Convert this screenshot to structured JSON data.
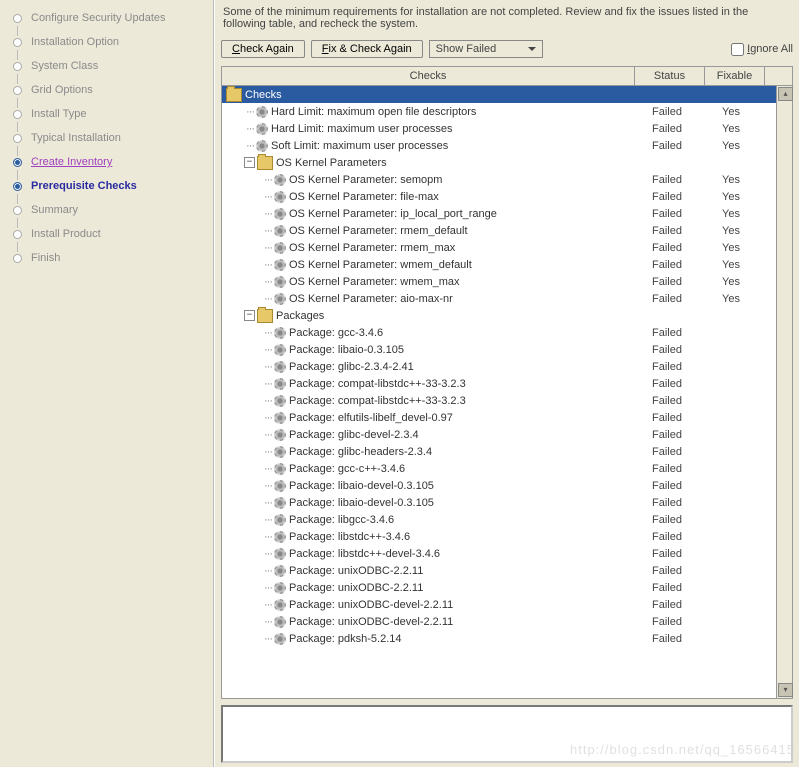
{
  "sidebar": {
    "steps": [
      {
        "label": "Configure Security Updates",
        "state": "pending"
      },
      {
        "label": "Installation Option",
        "state": "pending"
      },
      {
        "label": "System Class",
        "state": "pending"
      },
      {
        "label": "Grid Options",
        "state": "pending"
      },
      {
        "label": "Install Type",
        "state": "pending"
      },
      {
        "label": "Typical Installation",
        "state": "pending"
      },
      {
        "label": "Create Inventory",
        "state": "visited"
      },
      {
        "label": "Prerequisite Checks",
        "state": "current"
      },
      {
        "label": "Summary",
        "state": "pending"
      },
      {
        "label": "Install Product",
        "state": "pending"
      },
      {
        "label": "Finish",
        "state": "pending"
      }
    ]
  },
  "message": "Some of the minimum requirements for installation are not completed. Review and fix the issues listed in the following table, and recheck the system.",
  "buttons": {
    "check_again": "Check Again",
    "fix_check_again": "Fix & Check Again",
    "show_failed": "Show Failed",
    "ignore_all": "Ignore All"
  },
  "columns": {
    "checks": "Checks",
    "status": "Status",
    "fixable": "Fixable"
  },
  "tree": {
    "root": {
      "label": "Checks"
    },
    "limits": [
      {
        "label": "Hard Limit: maximum open file descriptors",
        "status": "Failed",
        "fixable": "Yes"
      },
      {
        "label": "Hard Limit: maximum user processes",
        "status": "Failed",
        "fixable": "Yes"
      },
      {
        "label": "Soft Limit: maximum user processes",
        "status": "Failed",
        "fixable": "Yes"
      }
    ],
    "kernel": {
      "label": "OS Kernel Parameters",
      "items": [
        {
          "label": "OS Kernel Parameter: semopm",
          "status": "Failed",
          "fixable": "Yes"
        },
        {
          "label": "OS Kernel Parameter: file-max",
          "status": "Failed",
          "fixable": "Yes"
        },
        {
          "label": "OS Kernel Parameter: ip_local_port_range",
          "status": "Failed",
          "fixable": "Yes"
        },
        {
          "label": "OS Kernel Parameter: rmem_default",
          "status": "Failed",
          "fixable": "Yes"
        },
        {
          "label": "OS Kernel Parameter: rmem_max",
          "status": "Failed",
          "fixable": "Yes"
        },
        {
          "label": "OS Kernel Parameter: wmem_default",
          "status": "Failed",
          "fixable": "Yes"
        },
        {
          "label": "OS Kernel Parameter: wmem_max",
          "status": "Failed",
          "fixable": "Yes"
        },
        {
          "label": "OS Kernel Parameter: aio-max-nr",
          "status": "Failed",
          "fixable": "Yes"
        }
      ]
    },
    "packages": {
      "label": "Packages",
      "items": [
        {
          "label": "Package: gcc-3.4.6",
          "status": "Failed",
          "fixable": ""
        },
        {
          "label": "Package: libaio-0.3.105",
          "status": "Failed",
          "fixable": ""
        },
        {
          "label": "Package: glibc-2.3.4-2.41",
          "status": "Failed",
          "fixable": ""
        },
        {
          "label": "Package: compat-libstdc++-33-3.2.3",
          "status": "Failed",
          "fixable": ""
        },
        {
          "label": "Package: compat-libstdc++-33-3.2.3",
          "status": "Failed",
          "fixable": ""
        },
        {
          "label": "Package: elfutils-libelf_devel-0.97",
          "status": "Failed",
          "fixable": ""
        },
        {
          "label": "Package: glibc-devel-2.3.4",
          "status": "Failed",
          "fixable": ""
        },
        {
          "label": "Package: glibc-headers-2.3.4",
          "status": "Failed",
          "fixable": ""
        },
        {
          "label": "Package: gcc-c++-3.4.6",
          "status": "Failed",
          "fixable": ""
        },
        {
          "label": "Package: libaio-devel-0.3.105",
          "status": "Failed",
          "fixable": ""
        },
        {
          "label": "Package: libaio-devel-0.3.105",
          "status": "Failed",
          "fixable": ""
        },
        {
          "label": "Package: libgcc-3.4.6",
          "status": "Failed",
          "fixable": ""
        },
        {
          "label": "Package: libstdc++-3.4.6",
          "status": "Failed",
          "fixable": ""
        },
        {
          "label": "Package: libstdc++-devel-3.4.6",
          "status": "Failed",
          "fixable": ""
        },
        {
          "label": "Package: unixODBC-2.2.11",
          "status": "Failed",
          "fixable": ""
        },
        {
          "label": "Package: unixODBC-2.2.11",
          "status": "Failed",
          "fixable": ""
        },
        {
          "label": "Package: unixODBC-devel-2.2.11",
          "status": "Failed",
          "fixable": ""
        },
        {
          "label": "Package: unixODBC-devel-2.2.11",
          "status": "Failed",
          "fixable": ""
        },
        {
          "label": "Package: pdksh-5.2.14",
          "status": "Failed",
          "fixable": ""
        }
      ]
    }
  },
  "watermark": "http://blog.csdn.net/qq_16566415"
}
